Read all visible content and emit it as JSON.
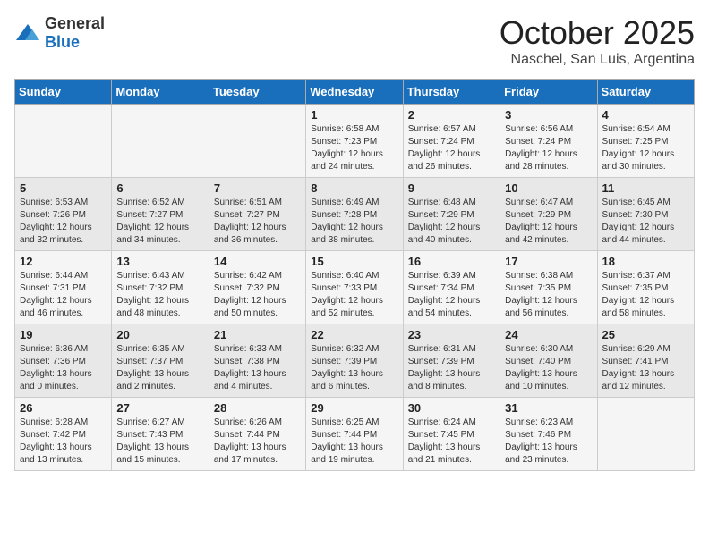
{
  "header": {
    "logo_general": "General",
    "logo_blue": "Blue",
    "month": "October 2025",
    "location": "Naschel, San Luis, Argentina"
  },
  "days_of_week": [
    "Sunday",
    "Monday",
    "Tuesday",
    "Wednesday",
    "Thursday",
    "Friday",
    "Saturday"
  ],
  "weeks": [
    [
      {
        "day": "",
        "info": ""
      },
      {
        "day": "",
        "info": ""
      },
      {
        "day": "",
        "info": ""
      },
      {
        "day": "1",
        "info": "Sunrise: 6:58 AM\nSunset: 7:23 PM\nDaylight: 12 hours\nand 24 minutes."
      },
      {
        "day": "2",
        "info": "Sunrise: 6:57 AM\nSunset: 7:24 PM\nDaylight: 12 hours\nand 26 minutes."
      },
      {
        "day": "3",
        "info": "Sunrise: 6:56 AM\nSunset: 7:24 PM\nDaylight: 12 hours\nand 28 minutes."
      },
      {
        "day": "4",
        "info": "Sunrise: 6:54 AM\nSunset: 7:25 PM\nDaylight: 12 hours\nand 30 minutes."
      }
    ],
    [
      {
        "day": "5",
        "info": "Sunrise: 6:53 AM\nSunset: 7:26 PM\nDaylight: 12 hours\nand 32 minutes."
      },
      {
        "day": "6",
        "info": "Sunrise: 6:52 AM\nSunset: 7:27 PM\nDaylight: 12 hours\nand 34 minutes."
      },
      {
        "day": "7",
        "info": "Sunrise: 6:51 AM\nSunset: 7:27 PM\nDaylight: 12 hours\nand 36 minutes."
      },
      {
        "day": "8",
        "info": "Sunrise: 6:49 AM\nSunset: 7:28 PM\nDaylight: 12 hours\nand 38 minutes."
      },
      {
        "day": "9",
        "info": "Sunrise: 6:48 AM\nSunset: 7:29 PM\nDaylight: 12 hours\nand 40 minutes."
      },
      {
        "day": "10",
        "info": "Sunrise: 6:47 AM\nSunset: 7:29 PM\nDaylight: 12 hours\nand 42 minutes."
      },
      {
        "day": "11",
        "info": "Sunrise: 6:45 AM\nSunset: 7:30 PM\nDaylight: 12 hours\nand 44 minutes."
      }
    ],
    [
      {
        "day": "12",
        "info": "Sunrise: 6:44 AM\nSunset: 7:31 PM\nDaylight: 12 hours\nand 46 minutes."
      },
      {
        "day": "13",
        "info": "Sunrise: 6:43 AM\nSunset: 7:32 PM\nDaylight: 12 hours\nand 48 minutes."
      },
      {
        "day": "14",
        "info": "Sunrise: 6:42 AM\nSunset: 7:32 PM\nDaylight: 12 hours\nand 50 minutes."
      },
      {
        "day": "15",
        "info": "Sunrise: 6:40 AM\nSunset: 7:33 PM\nDaylight: 12 hours\nand 52 minutes."
      },
      {
        "day": "16",
        "info": "Sunrise: 6:39 AM\nSunset: 7:34 PM\nDaylight: 12 hours\nand 54 minutes."
      },
      {
        "day": "17",
        "info": "Sunrise: 6:38 AM\nSunset: 7:35 PM\nDaylight: 12 hours\nand 56 minutes."
      },
      {
        "day": "18",
        "info": "Sunrise: 6:37 AM\nSunset: 7:35 PM\nDaylight: 12 hours\nand 58 minutes."
      }
    ],
    [
      {
        "day": "19",
        "info": "Sunrise: 6:36 AM\nSunset: 7:36 PM\nDaylight: 13 hours\nand 0 minutes."
      },
      {
        "day": "20",
        "info": "Sunrise: 6:35 AM\nSunset: 7:37 PM\nDaylight: 13 hours\nand 2 minutes."
      },
      {
        "day": "21",
        "info": "Sunrise: 6:33 AM\nSunset: 7:38 PM\nDaylight: 13 hours\nand 4 minutes."
      },
      {
        "day": "22",
        "info": "Sunrise: 6:32 AM\nSunset: 7:39 PM\nDaylight: 13 hours\nand 6 minutes."
      },
      {
        "day": "23",
        "info": "Sunrise: 6:31 AM\nSunset: 7:39 PM\nDaylight: 13 hours\nand 8 minutes."
      },
      {
        "day": "24",
        "info": "Sunrise: 6:30 AM\nSunset: 7:40 PM\nDaylight: 13 hours\nand 10 minutes."
      },
      {
        "day": "25",
        "info": "Sunrise: 6:29 AM\nSunset: 7:41 PM\nDaylight: 13 hours\nand 12 minutes."
      }
    ],
    [
      {
        "day": "26",
        "info": "Sunrise: 6:28 AM\nSunset: 7:42 PM\nDaylight: 13 hours\nand 13 minutes."
      },
      {
        "day": "27",
        "info": "Sunrise: 6:27 AM\nSunset: 7:43 PM\nDaylight: 13 hours\nand 15 minutes."
      },
      {
        "day": "28",
        "info": "Sunrise: 6:26 AM\nSunset: 7:44 PM\nDaylight: 13 hours\nand 17 minutes."
      },
      {
        "day": "29",
        "info": "Sunrise: 6:25 AM\nSunset: 7:44 PM\nDaylight: 13 hours\nand 19 minutes."
      },
      {
        "day": "30",
        "info": "Sunrise: 6:24 AM\nSunset: 7:45 PM\nDaylight: 13 hours\nand 21 minutes."
      },
      {
        "day": "31",
        "info": "Sunrise: 6:23 AM\nSunset: 7:46 PM\nDaylight: 13 hours\nand 23 minutes."
      },
      {
        "day": "",
        "info": ""
      }
    ]
  ]
}
